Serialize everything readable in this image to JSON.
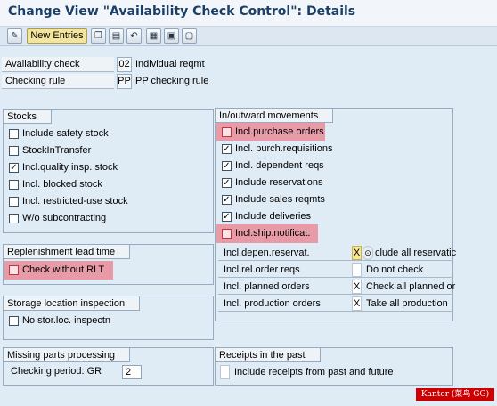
{
  "header": {
    "title": "Change View \"Availability Check Control\": Details"
  },
  "toolbar": {
    "new_entries_label": "New Entries",
    "icons": [
      "edit-pencil-icon",
      "copy-icon",
      "delete-icon",
      "undo-icon",
      "select-all-icon",
      "select-block-icon",
      "deselect-icon"
    ]
  },
  "header_fields": {
    "availability_check": {
      "label": "Availability check",
      "code": "02",
      "text": "Individual reqmt"
    },
    "checking_rule": {
      "label": "Checking rule",
      "code": "PP",
      "text": "PP checking rule"
    }
  },
  "stocks": {
    "title": "Stocks",
    "items": [
      {
        "label": "Include safety stock",
        "checked": false
      },
      {
        "label": "StockInTransfer",
        "checked": false
      },
      {
        "label": "Incl.quality insp. stock",
        "checked": true
      },
      {
        "label": "Incl. blocked stock",
        "checked": false
      },
      {
        "label": "Incl. restricted-use stock",
        "checked": false
      },
      {
        "label": "W/o subcontracting",
        "checked": false
      }
    ]
  },
  "movements": {
    "title": "In/outward movements",
    "items": [
      {
        "label": "Incl.purchase orders",
        "checked": false
      },
      {
        "label": "Incl. purch.requisitions",
        "checked": true
      },
      {
        "label": "Incl. dependent reqs",
        "checked": true
      },
      {
        "label": "Include reservations",
        "checked": true
      },
      {
        "label": "Include sales reqmts",
        "checked": true
      },
      {
        "label": "Include deliveries",
        "checked": true
      },
      {
        "label": "Incl.ship.notificat.",
        "checked": false
      }
    ],
    "table": [
      {
        "label": "Incl.depen.reservat.",
        "value": "X",
        "text": "clude all reservatic"
      },
      {
        "label": "Incl.rel.order reqs",
        "value": "",
        "text": "Do not check"
      },
      {
        "label": "Incl. planned orders",
        "value": "X",
        "text": "Check all planned or"
      },
      {
        "label": "Incl. production orders",
        "value": "X",
        "text": "Take all production"
      }
    ]
  },
  "replenishment": {
    "title": "Replenishment lead time",
    "item": {
      "label": "Check without RLT",
      "checked": false
    }
  },
  "storage": {
    "title": "Storage location inspection",
    "item": {
      "label": "No stor.loc. inspectn",
      "checked": false
    }
  },
  "missing": {
    "title": "Missing parts processing",
    "field_label": "Checking period: GR",
    "field_value": "2"
  },
  "receipts": {
    "title": "Receipts in the past",
    "item": {
      "label": "Include receipts from past and future",
      "checked": false
    }
  },
  "watermark": {
    "text": "Kanter (菜鸟 GG)"
  },
  "colors": {
    "highlight": "#e89aa6",
    "title": "#1b3f66",
    "new_entries_bg": "#f3e59d"
  }
}
